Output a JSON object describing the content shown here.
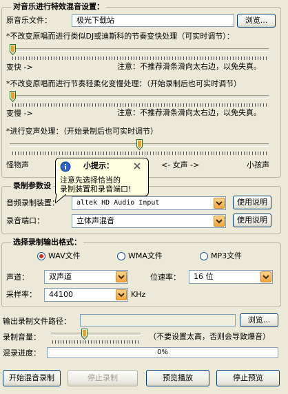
{
  "effects": {
    "title": "对音乐进行特效混音设置：",
    "music_file_label": "原音乐文件：",
    "music_file_value": "极光下载站",
    "browse_label": "浏览...",
    "tempo_label": "*不改变原唱而进行类似DJ或迪斯科的节奏变快处理（可实时调节）：",
    "tempo_left": "变快 ->",
    "tempo_note": "注意：不推荐滑条滑向太右边，以免失真。",
    "tempo_value": 0,
    "slow_label": "*不改变原唱而进行节奏轻柔化变慢处理：（开始录制后也可实时调节）",
    "slow_left": "变慢 ->",
    "slow_note": "注意：不推荐滑条滑向太右边，以免失真。",
    "slow_value": 0,
    "pitch_label": "*进行变声处理：（开始录制后也可实时调节）",
    "pitch_left": "怪物声",
    "pitch_mid": "<- 女声 ->",
    "pitch_right": "小孩声",
    "pitch_value": 0.5
  },
  "record": {
    "title": "录制参数设",
    "device_label": "音频录制装置：",
    "device_value": "altek HD Audio Input",
    "port_label": "录音端口：",
    "port_value": "立体声混音",
    "help_label": "使用说明"
  },
  "tooltip": {
    "title": "小提示：",
    "text_line1": "注意先选择恰当的",
    "text_line2": "录制装置和录音端口!"
  },
  "format": {
    "title": "选择录制输出格式：",
    "options": [
      "WAV文件",
      "WMA文件",
      "MP3文件"
    ],
    "selected": "WAV文件",
    "channel_label": "声道：",
    "channel_value": "双声道",
    "bitrate_label": "位速率：",
    "bitrate_value": "16 位",
    "sample_label": "采样率：",
    "sample_value": "44100",
    "sample_unit": "KHz"
  },
  "output": {
    "path_label": "输出录制文件路径：",
    "path_value": "",
    "browse_label": "浏览...",
    "volume_label": "录制音量：",
    "volume_note": "（不要设置太高，否则会导致爆音）",
    "volume_value": 0.36,
    "progress_label": "混录进度：",
    "progress_text": "0%",
    "progress_value": 0
  },
  "buttons": {
    "start": "开始混音录制",
    "stop": "停止录制",
    "preview": "预览播放",
    "stop_preview": "停止预览"
  }
}
